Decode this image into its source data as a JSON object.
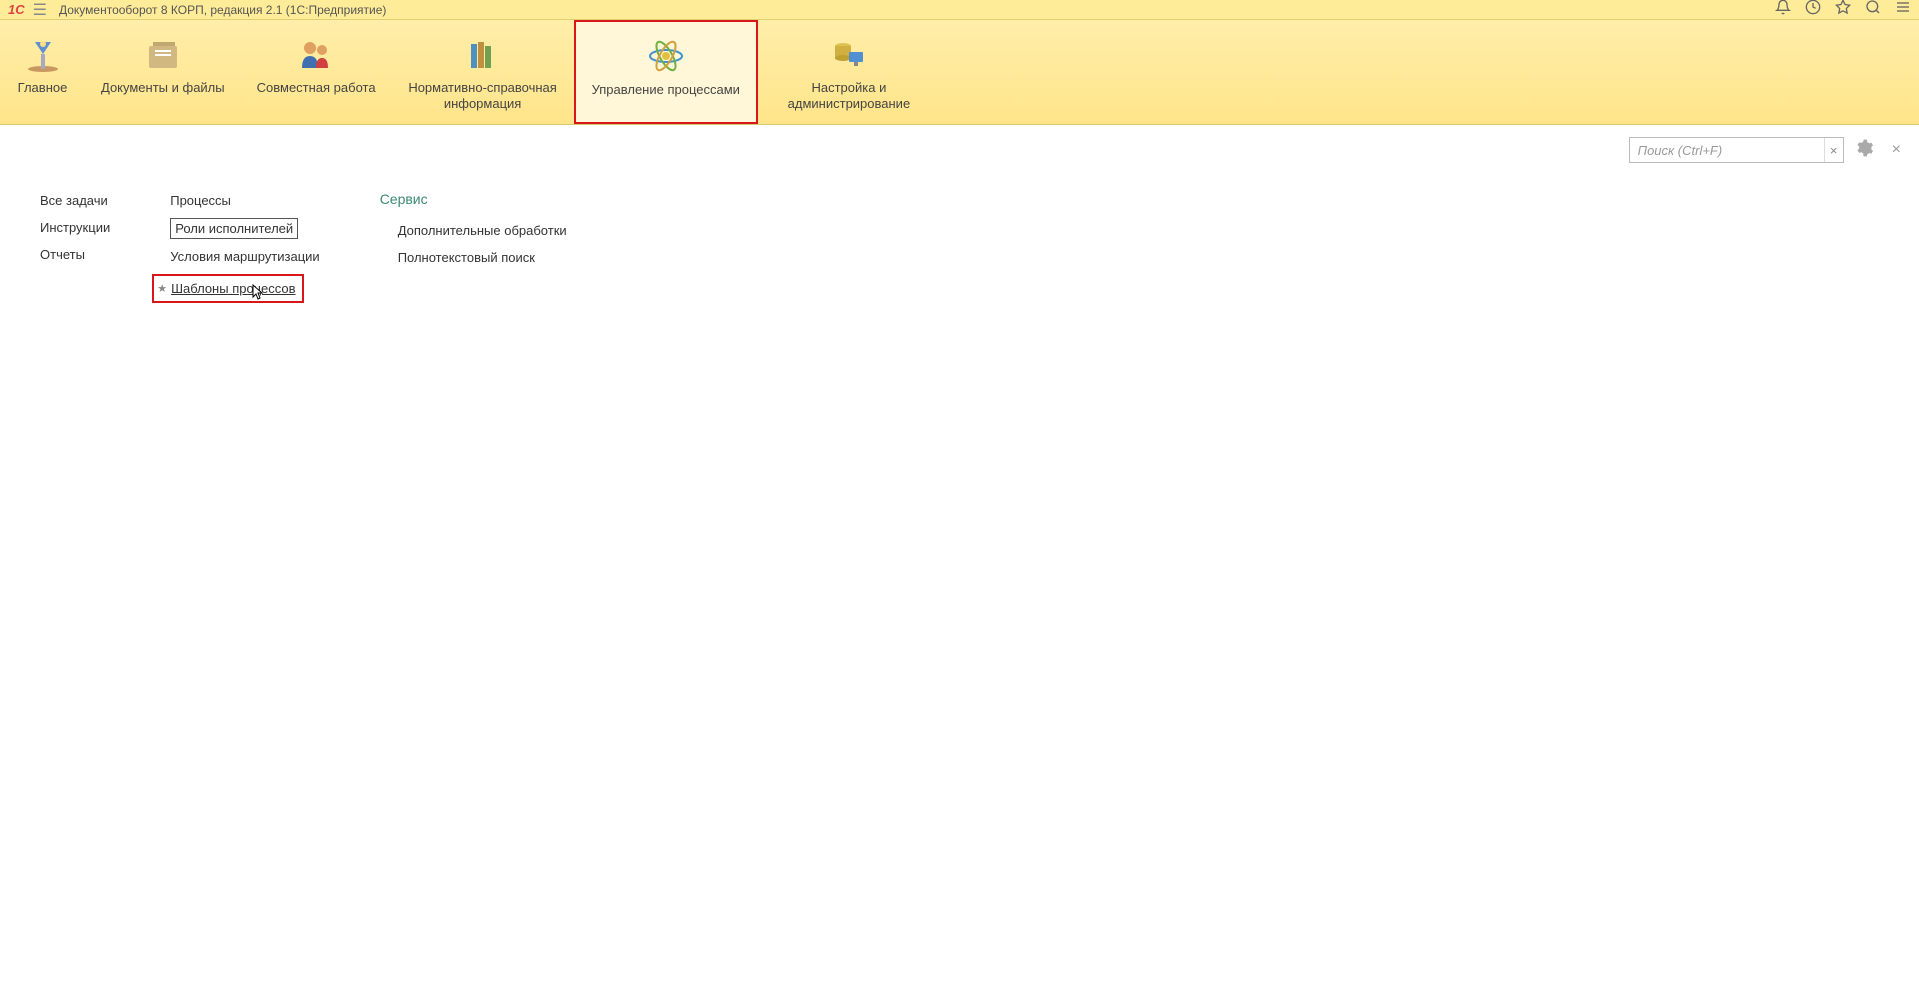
{
  "title_bar": {
    "logo_text": "1С",
    "app_title": "Документооборот 8 КОРП, редакция 2.1  (1С:Предприятие)"
  },
  "nav": {
    "sections": [
      {
        "label": "Главное"
      },
      {
        "label": "Документы и файлы"
      },
      {
        "label": "Совместная работа"
      },
      {
        "label": "Нормативно-справочная информация"
      },
      {
        "label": "Управление процессами"
      },
      {
        "label": "Настройка и администрирование"
      }
    ]
  },
  "search": {
    "placeholder": "Поиск (Ctrl+F)"
  },
  "columns": {
    "col1": {
      "items": [
        "Все задачи",
        "Инструкции",
        "Отчеты"
      ]
    },
    "col2": {
      "items": [
        "Процессы",
        "Роли исполнителей",
        "Условия маршрутизации",
        "Шаблоны процессов"
      ]
    },
    "col3": {
      "heading": "Сервис",
      "items": [
        "Дополнительные обработки",
        "Полнотекстовый поиск"
      ]
    }
  }
}
